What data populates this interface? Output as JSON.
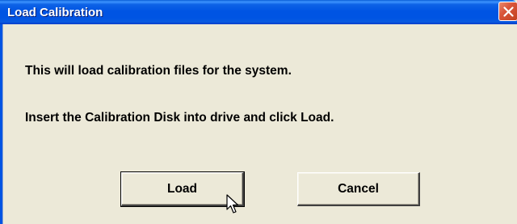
{
  "window": {
    "title": "Load Calibration"
  },
  "message": {
    "line1": "This will load calibration files for the system.",
    "line2": "Insert the Calibration Disk into drive and click Load."
  },
  "buttons": {
    "load_label": "Load",
    "cancel_label": "Cancel"
  },
  "icons": {
    "close": "close-icon",
    "cursor": "mouse-pointer-icon"
  },
  "colors": {
    "titlebar": "#0054E3",
    "face": "#ECE9D8",
    "close": "#D9553A"
  }
}
